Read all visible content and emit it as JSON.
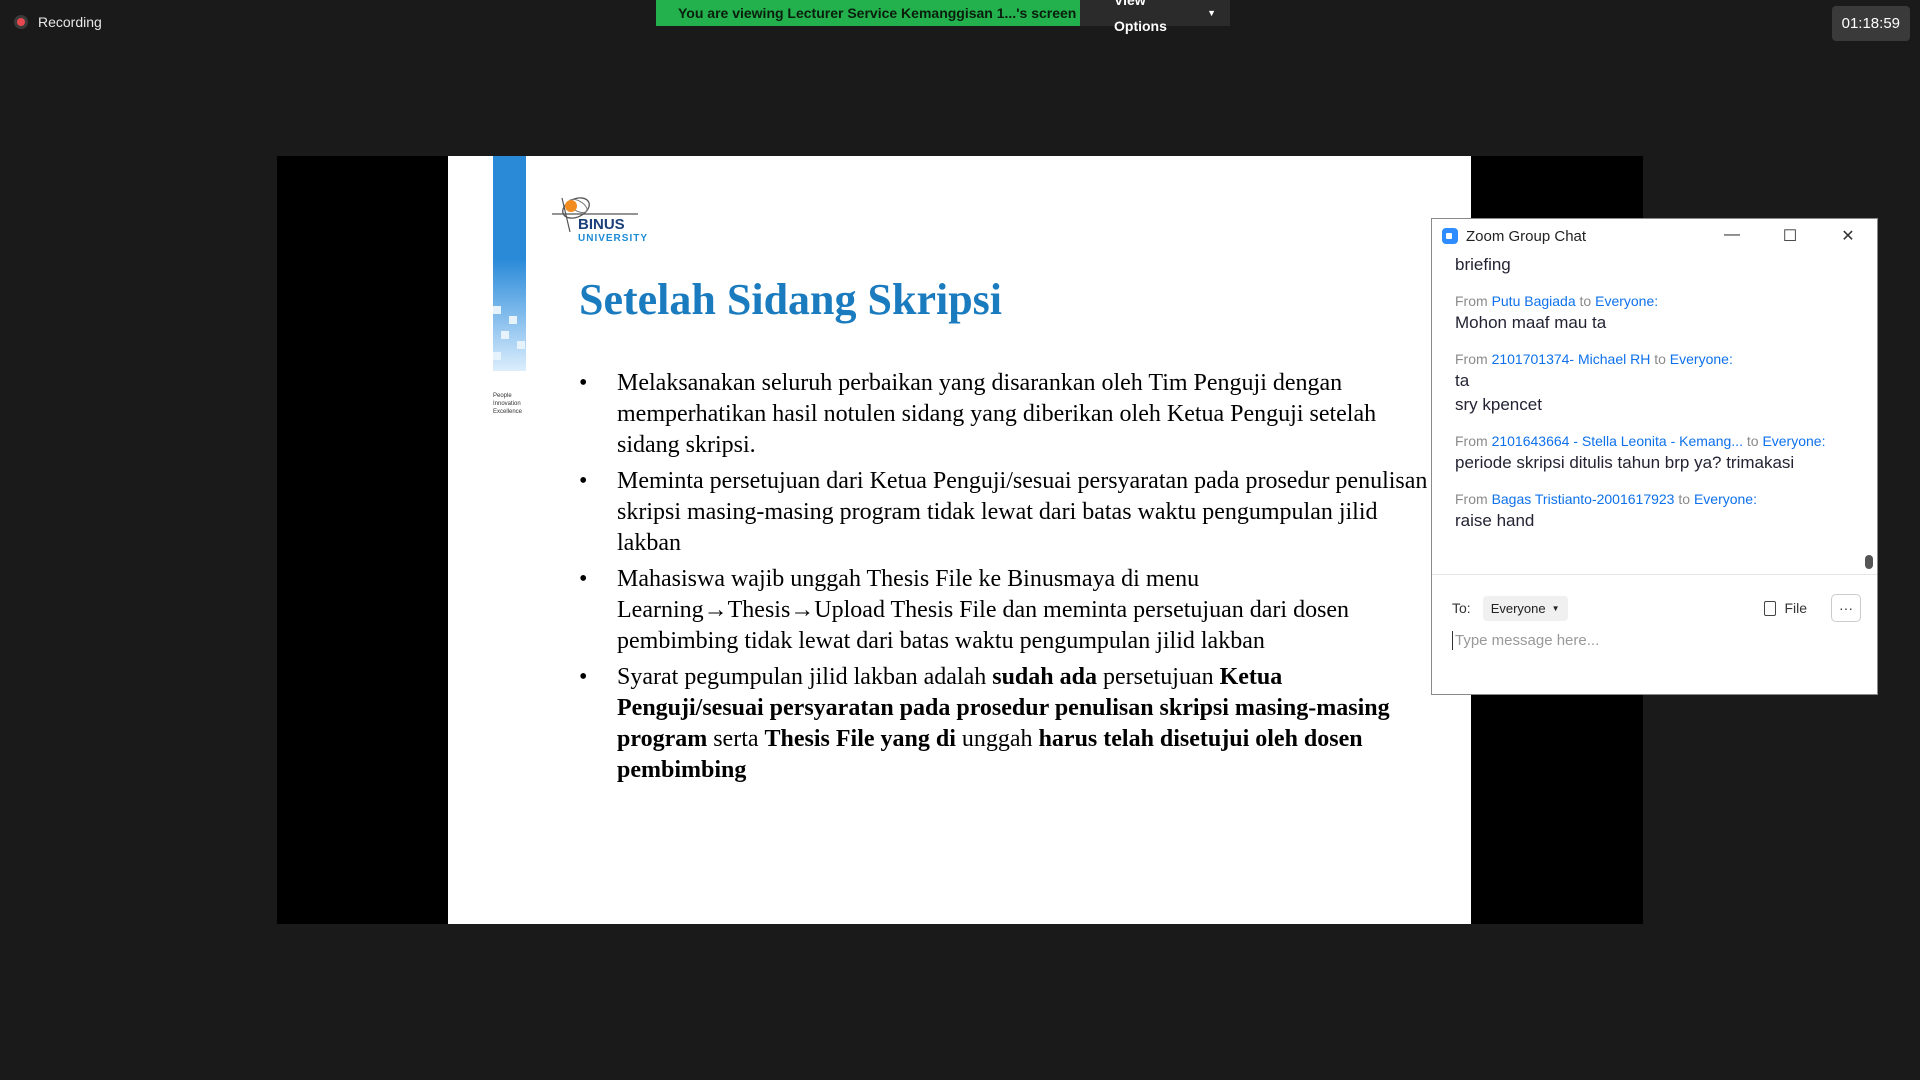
{
  "recording": {
    "label": "Recording"
  },
  "banner": {
    "viewing_text": "You are viewing Lecturer Service Kemanggisan 1...'s screen",
    "view_options_label": "View Options"
  },
  "timer": "01:18:59",
  "slide": {
    "logo_word": "BINUS",
    "logo_sub": "UNIVERSITY",
    "tagline": [
      "People",
      "Innovation",
      "Excellence"
    ],
    "title": "Setelah Sidang Skripsi",
    "bullets": [
      [
        {
          "t": "Melaksanakan seluruh perbaikan yang disarankan oleh Tim Penguji dengan memperhatikan hasil notulen sidang yang diberikan oleh Ketua Penguji setelah sidang skripsi.",
          "b": false
        }
      ],
      [
        {
          "t": "Meminta persetujuan dari Ketua Penguji/sesuai persyaratan pada prosedur penulisan skripsi masing-masing program tidak lewat dari batas waktu pengumpulan jilid lakban",
          "b": false
        }
      ],
      [
        {
          "t": "Mahasiswa wajib unggah Thesis File ke Binusmaya di menu Learning→Thesis→Upload Thesis File dan meminta persetujuan dari dosen pembimbing tidak lewat dari batas waktu pengumpulan jilid lakban",
          "b": false
        }
      ],
      [
        {
          "t": "Syarat pegumpulan jilid lakban adalah ",
          "b": false
        },
        {
          "t": "sudah ada",
          "b": true
        },
        {
          "t": " persetujuan ",
          "b": false
        },
        {
          "t": "Ketua Penguji/sesuai persyaratan pada prosedur penulisan skripsi masing-masing program",
          "b": true
        },
        {
          "t": " serta ",
          "b": false
        },
        {
          "t": "Thesis File yang di",
          "b": true
        },
        {
          "t": " unggah ",
          "b": false
        },
        {
          "t": "harus telah disetujui oleh dosen pembimbing",
          "b": true
        }
      ]
    ]
  },
  "chat": {
    "title": "Zoom Group Chat",
    "messages": [
      {
        "from": "",
        "to": "",
        "lines": [
          "briefing"
        ]
      },
      {
        "from": "Putu Bagiada",
        "to": "Everyone:",
        "lines": [
          "Mohon maaf mau ta"
        ]
      },
      {
        "from": "2101701374- Michael RH",
        "to": "Everyone:",
        "lines": [
          "ta",
          "sry kpencet"
        ]
      },
      {
        "from": "2101643664 - Stella Leonita - Kemang...",
        "to": "Everyone:",
        "lines": [
          "periode skripsi ditulis tahun brp ya? trimakasi"
        ]
      },
      {
        "from": "Bagas Tristianto-2001617923",
        "to": "Everyone:",
        "lines": [
          "raise hand"
        ]
      }
    ],
    "from_word": "From",
    "to_word": "to",
    "to_label": "To:",
    "recipient": "Everyone",
    "file_label": "File",
    "more_label": "···",
    "input_placeholder": "Type message here..."
  }
}
